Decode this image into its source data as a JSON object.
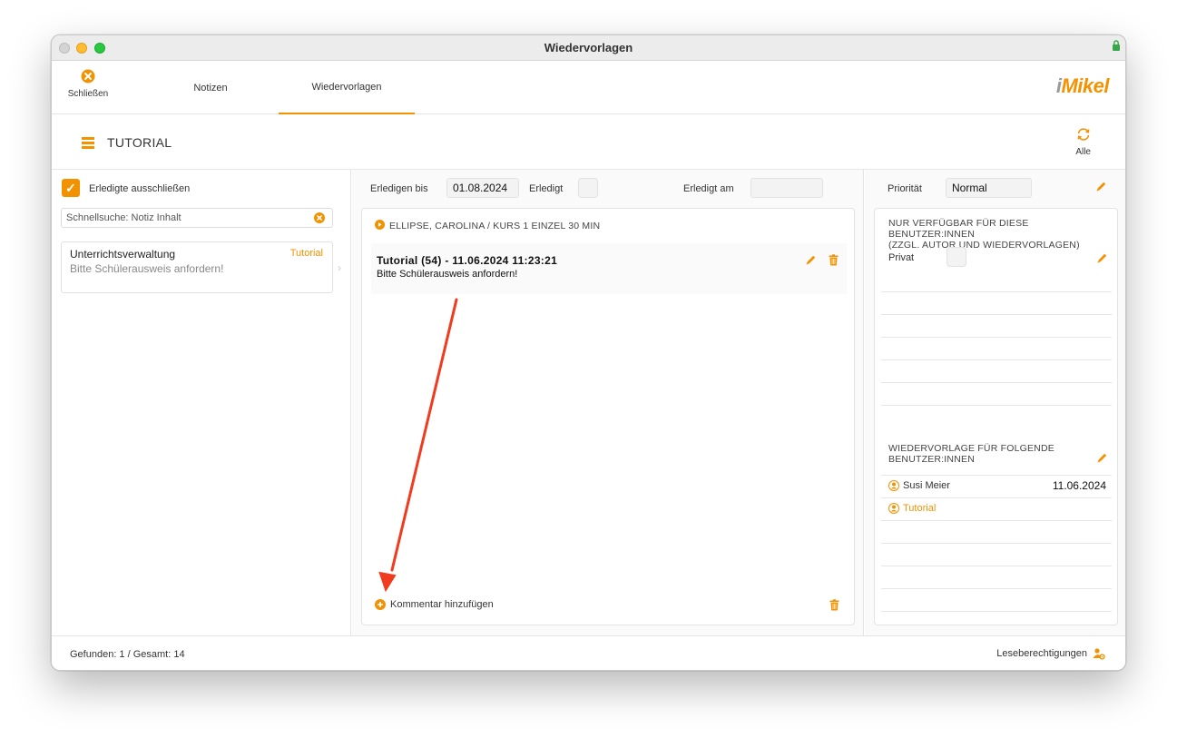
{
  "window": {
    "title": "Wiedervorlagen"
  },
  "toolbar": {
    "close_label": "Schließen",
    "tabs": [
      {
        "label": "Notizen"
      },
      {
        "label": "Wiedervorlagen"
      }
    ],
    "logo_text_i": "i",
    "logo_text": "Mikel"
  },
  "header": {
    "title": "TUTORIAL",
    "refresh_label": "Alle"
  },
  "sidebar": {
    "exclude_done_label": "Erledigte ausschließen",
    "exclude_done_checked": true,
    "search_placeholder": "Schnellsuche: Notiz Inhalt",
    "items": [
      {
        "title": "Unterrichtsverwaltung",
        "subtitle": "Bitte Schülerausweis anfordern!",
        "tag": "Tutorial"
      }
    ]
  },
  "detail": {
    "due_label": "Erledigen bis",
    "due_value": "01.08.2024",
    "done_label": "Erledigt",
    "done_at_label": "Erledigt am",
    "done_at_value": "",
    "entry_header": "ELLIPSE, CAROLINA / KURS 1 EINZEL 30 MIN",
    "note_title": "Tutorial (54) - 11.06.2024 11:23:21",
    "note_body": "Bitte Schülerausweis anfordern!",
    "add_comment_label": "Kommentar hinzufügen"
  },
  "right": {
    "priority_label": "Priorität",
    "priority_value": "Normal",
    "availability_title_1": "NUR VERFÜGBAR FÜR DIESE BENUTZER:INNEN",
    "availability_title_2": "(ZZGL. AUTOR UND WIEDERVORLAGEN)",
    "private_label": "Privat",
    "followup_title_1": "WIEDERVORLAGE FÜR FOLGENDE",
    "followup_title_2": "BENUTZER:INNEN",
    "users": [
      {
        "name": "Susi Meier",
        "date": "11.06.2024"
      },
      {
        "name": "Tutorial",
        "date": ""
      }
    ]
  },
  "status": {
    "found_text": "Gefunden: 1 / Gesamt: 14",
    "read_permissions_label": "Leseberechtigungen"
  },
  "colors": {
    "accent": "#f39200",
    "annotation_arrow": "#f03b1e"
  }
}
